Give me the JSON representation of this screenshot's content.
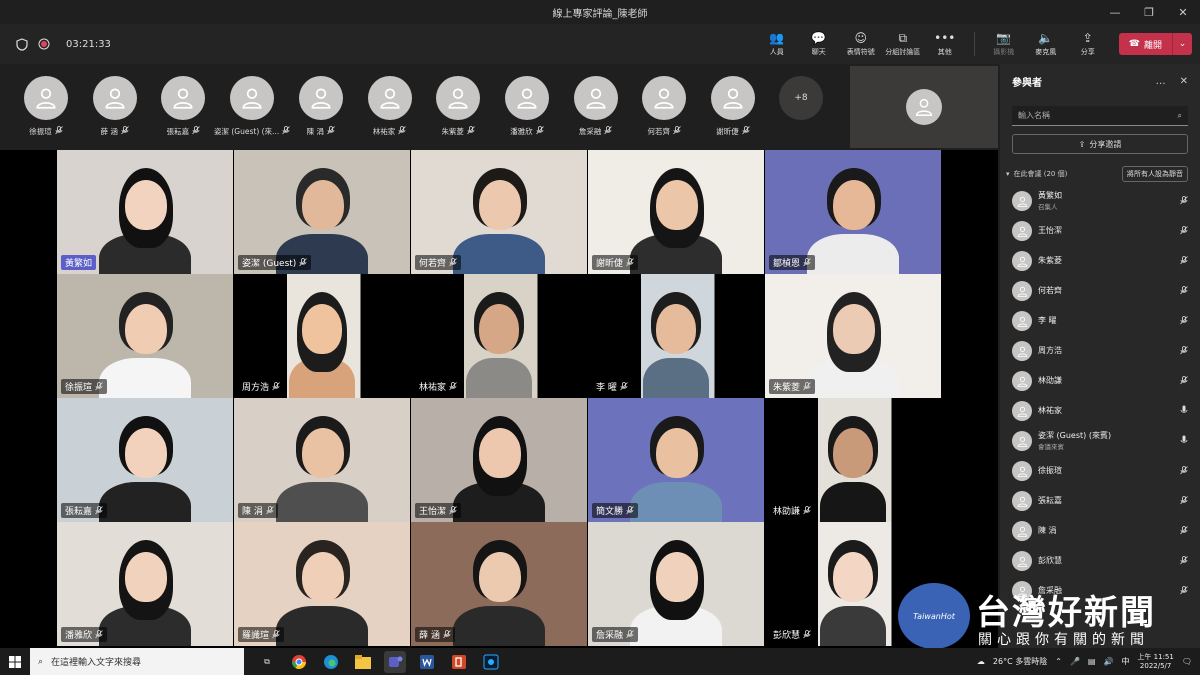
{
  "window": {
    "title": "線上專家評論_陳老師",
    "controls": [
      "—",
      "❐",
      "✕"
    ]
  },
  "toolbar": {
    "timer": "03:21:33",
    "buttons": [
      {
        "label": "人員",
        "icon": "people-icon",
        "glyph": "👥"
      },
      {
        "label": "聊天",
        "icon": "chat-icon",
        "glyph": "💬"
      },
      {
        "label": "表情符號",
        "icon": "emoji-icon",
        "glyph": "☺"
      },
      {
        "label": "分組討論區",
        "icon": "breakout-icon",
        "glyph": "⧉"
      },
      {
        "label": "其他",
        "icon": "more-icon",
        "glyph": "•••"
      }
    ],
    "camera": {
      "label": "攝影機",
      "icon": "camera-off-icon",
      "glyph": "📷"
    },
    "mic": {
      "label": "麥克風",
      "icon": "mic-icon",
      "glyph": "🔈"
    },
    "share": {
      "label": "分享",
      "icon": "share-icon",
      "glyph": "⇪"
    },
    "leave": {
      "label": "離開",
      "icon": "phone-icon",
      "glyph": "☎"
    }
  },
  "strip": {
    "avatars": [
      "徐振瑄",
      "薛 涵",
      "張耘嘉",
      "姿潔 (Guest) (來...",
      "陳 涓",
      "林祐家",
      "朱紫菱",
      "潘雅欣",
      "詹采融",
      "何若齊",
      "謝昕倢"
    ],
    "more": "+8"
  },
  "grid": {
    "tiles": [
      {
        "name": "黃繁如",
        "active": true
      },
      {
        "name": "姿潔 (Guest)"
      },
      {
        "name": "何若齊"
      },
      {
        "name": "謝昕倢"
      },
      {
        "name": "鄒楨恩"
      },
      {
        "name": "徐振瑄"
      },
      {
        "name": "周方浩"
      },
      {
        "name": "林祐家"
      },
      {
        "name": "李 曜"
      },
      {
        "name": "朱紫菱"
      },
      {
        "name": "張耘嘉"
      },
      {
        "name": "陳 涓"
      },
      {
        "name": "王怡潔"
      },
      {
        "name": "簡文勝"
      },
      {
        "name": "林劭謙"
      },
      {
        "name": "潘雅欣"
      },
      {
        "name": "羅識瑄"
      },
      {
        "name": "薛 涵"
      },
      {
        "name": "詹采融"
      },
      {
        "name": "彭欣慧"
      }
    ]
  },
  "panel": {
    "title": "參與者",
    "search_placeholder": "輸入名稱",
    "share_invite": "分享邀請",
    "section": "在此會議 (20 個)",
    "mute_all": "將所有人設為靜音",
    "participants": [
      {
        "name": "黃繁如",
        "sub": "召集人",
        "mic": "muted"
      },
      {
        "name": "王怡潔",
        "mic": "muted"
      },
      {
        "name": "朱紫菱",
        "mic": "muted"
      },
      {
        "name": "何若齊",
        "mic": "muted"
      },
      {
        "name": "李 曜",
        "mic": "muted"
      },
      {
        "name": "周方浩",
        "mic": "muted"
      },
      {
        "name": "林劭謙",
        "mic": "muted"
      },
      {
        "name": "林祐家",
        "mic": "on"
      },
      {
        "name": "姿潔 (Guest) (來賓)",
        "sub": "會議來賓",
        "mic": "on"
      },
      {
        "name": "徐振瑄",
        "mic": "muted"
      },
      {
        "name": "張耘嘉",
        "mic": "muted"
      },
      {
        "name": "陳 涓",
        "mic": "muted"
      },
      {
        "name": "彭欣慧",
        "mic": "muted"
      },
      {
        "name": "詹采融",
        "mic": "muted"
      }
    ]
  },
  "watermark": {
    "logo": "TaiwanHot",
    "title": "台灣好新聞",
    "slogan": "關心跟你有關的新聞"
  },
  "taskbar": {
    "search_placeholder": "在這裡輸入文字來搜尋",
    "weather": "26°C 多雲時陰",
    "ime": "中",
    "time": "上午 11:51",
    "date": "2022/5/7"
  },
  "colors": {
    "leave": "#c4314b",
    "active_name": "#5b5fc7",
    "panel_bg": "#292828",
    "watermark_logo": "#3b63b5"
  }
}
